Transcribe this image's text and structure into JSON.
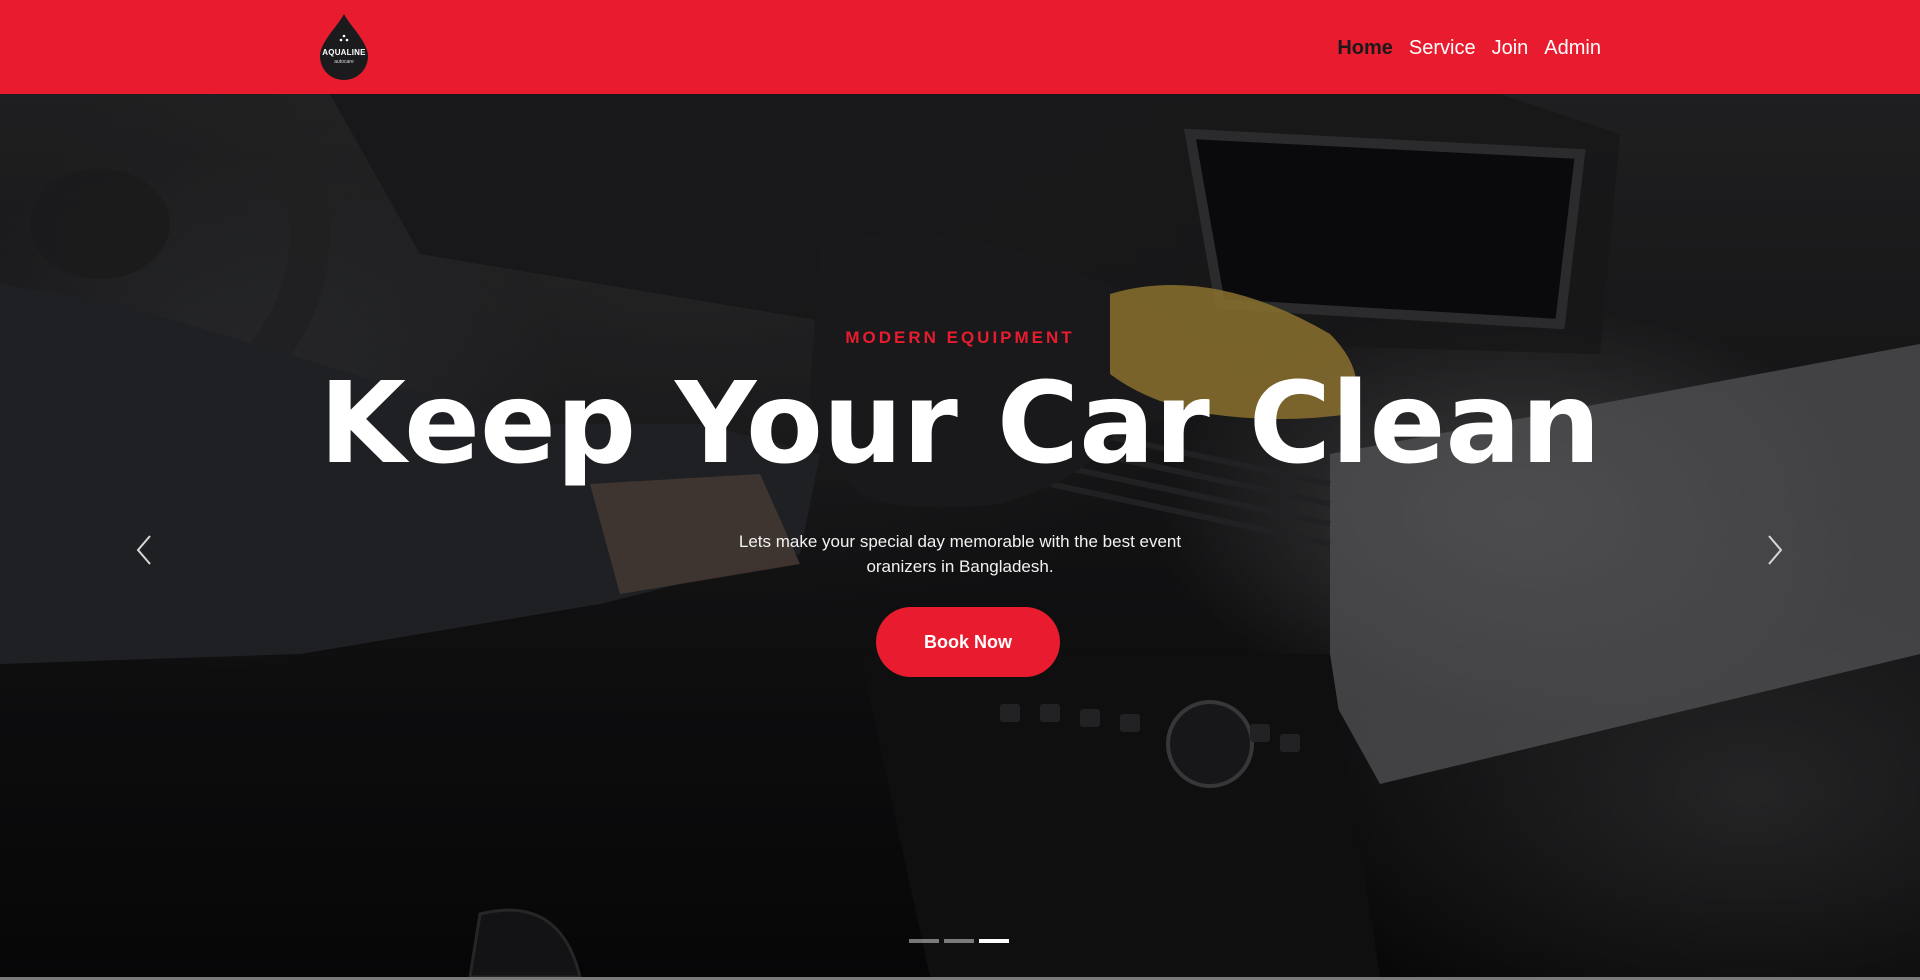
{
  "brand": {
    "logo_icon": "water-drop-logo",
    "name": "AQUALINE",
    "tagline": "autocare",
    "accent_color": "#e81c2e"
  },
  "nav": {
    "items": [
      {
        "label": "Home",
        "active": true
      },
      {
        "label": "Service",
        "active": false
      },
      {
        "label": "Join",
        "active": false
      },
      {
        "label": "Admin",
        "active": false
      }
    ]
  },
  "hero": {
    "eyebrow": "MODERN EQUIPMENT",
    "headline": "Keep Your Car Clean",
    "subtext": "Lets make your special day memorable with the best event oranizers in Bangladesh.",
    "cta_label": "Book Now",
    "prev_icon": "chevron-left-icon",
    "next_icon": "chevron-right-icon",
    "slides_total": 3,
    "active_slide": 3
  }
}
